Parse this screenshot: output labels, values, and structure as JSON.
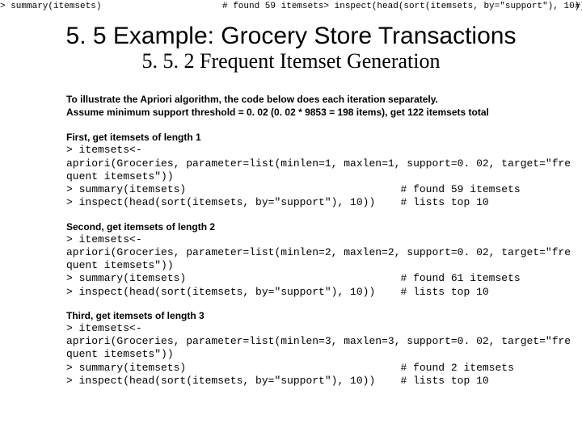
{
  "topbar": {
    "left": "> summary(itemsets)",
    "mid": "# found 59 itemsets> inspect(head(sort(itemsets, by=\"support\"), 10))",
    "right": "#"
  },
  "title": {
    "main": "5. 5 Example: Grocery Store Transactions",
    "sub": "5. 5. 2 Frequent Itemset Generation"
  },
  "intro": {
    "line1": "To illustrate the Apriori algorithm, the code below does each iteration separately.",
    "line2": "Assume minimum support threshold = 0. 02 (0. 02 * 9853 = 198 items), get 122 itemsets total"
  },
  "sections": [
    {
      "head": "First, get itemsets of length 1",
      "code": "> itemsets<-\napriori(Groceries, parameter=list(minlen=1, maxlen=1, support=0. 02, target=\"fre\nquent itemsets\"))\n> summary(itemsets)                                  # found 59 itemsets\n> inspect(head(sort(itemsets, by=\"support\"), 10))    # lists top 10"
    },
    {
      "head": "Second, get itemsets of length 2",
      "code": "> itemsets<-\napriori(Groceries, parameter=list(minlen=2, maxlen=2, support=0. 02, target=\"fre\nquent itemsets\"))\n> summary(itemsets)                                  # found 61 itemsets\n> inspect(head(sort(itemsets, by=\"support\"), 10))    # lists top 10"
    },
    {
      "head": "Third, get itemsets of length 3",
      "code": "> itemsets<-\napriori(Groceries, parameter=list(minlen=3, maxlen=3, support=0. 02, target=\"fre\nquent itemsets\"))\n> summary(itemsets)                                  # found 2 itemsets\n> inspect(head(sort(itemsets, by=\"support\"), 10))    # lists top 10"
    }
  ]
}
